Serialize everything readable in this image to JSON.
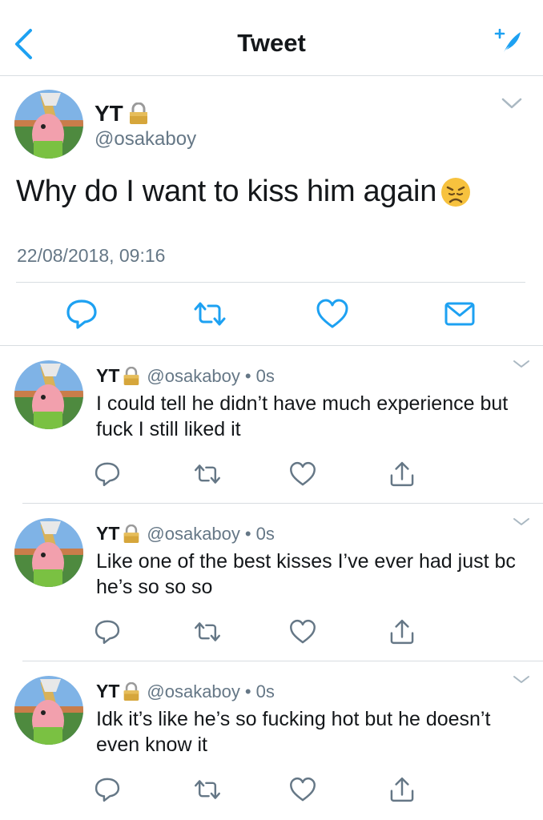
{
  "header": {
    "title": "Tweet",
    "accent": "#1da1f2"
  },
  "icons": {
    "back": "chevron-left-icon",
    "compose": "compose-quill-icon",
    "reply": "reply-bubble-icon",
    "retweet": "retweet-icon",
    "like": "heart-icon",
    "dm": "envelope-icon",
    "share": "share-icon",
    "more": "chevron-down-icon",
    "protected": "lock-icon"
  },
  "main_tweet": {
    "name": "YT",
    "handle": "@osakaboy",
    "text": "Why do I want to kiss him again",
    "emoji": "😞",
    "timestamp": "22/08/2018, 09:16"
  },
  "replies": [
    {
      "name": "YT",
      "handle": "@osakaboy",
      "separator": "•",
      "time": "0s",
      "text": "I could tell he didn’t have much experience but fuck I still liked it"
    },
    {
      "name": "YT",
      "handle": "@osakaboy",
      "separator": "•",
      "time": "0s",
      "text": "Like one of the best kisses I’ve ever had just bc he’s so so so"
    },
    {
      "name": "YT",
      "handle": "@osakaboy",
      "separator": "•",
      "time": "0s",
      "text": "Idk it’s like he’s so fucking hot but he doesn’t even know it"
    }
  ],
  "colors": {
    "text": "#14171a",
    "secondary": "#657786",
    "divider": "#d8dde1",
    "icon": "#657786",
    "main_icon": "#1da1f2"
  }
}
